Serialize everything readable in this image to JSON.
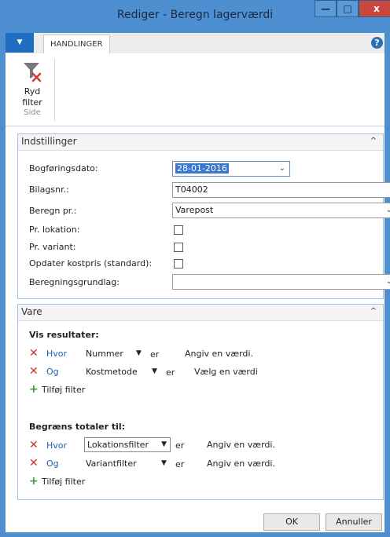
{
  "window": {
    "title": "Rediger - Beregn lagerværdi",
    "minimize": "—",
    "maximize": "□",
    "close": "x"
  },
  "ribbon": {
    "tab": "HANDLINGER",
    "clear_filter_line1": "Ryd",
    "clear_filter_line2": "filter",
    "group_label": "Side",
    "help": "?"
  },
  "settings": {
    "title": "Indstillinger",
    "fields": {
      "posting_date_label": "Bogføringsdato:",
      "posting_date_value": "28-01-2016",
      "document_no_label": "Bilagsnr.:",
      "document_no_value": "T04002",
      "calc_per_label": "Beregn pr.:",
      "calc_per_value": "Varepost",
      "by_location_label": "Pr. lokation:",
      "by_variant_label": "Pr. variant:",
      "update_std_cost_label": "Opdater kostpris (standard):",
      "calc_base_label": "Beregningsgrundlag:",
      "calc_base_value": ""
    }
  },
  "item": {
    "title": "Vare",
    "show_results": {
      "heading": "Vis resultater:",
      "rows": [
        {
          "conj": "Hvor",
          "field": "Nummer",
          "op": "er",
          "value": "Angiv en værdi."
        },
        {
          "conj": "Og",
          "field": "Kostmetode",
          "op": "er",
          "value": "Vælg en værdi"
        }
      ],
      "add_filter": "Tilføj filter"
    },
    "limit_totals": {
      "heading": "Begræns totaler til:",
      "rows": [
        {
          "conj": "Hvor",
          "field": "Lokationsfilter",
          "op": "er",
          "value": "Angiv en værdi."
        },
        {
          "conj": "Og",
          "field": "Variantfilter",
          "op": "er",
          "value": "Angiv en værdi."
        }
      ],
      "add_filter": "Tilføj filter"
    }
  },
  "buttons": {
    "ok": "OK",
    "cancel": "Annuller"
  },
  "colors": {
    "accent": "#4d8fd0",
    "remove": "#c8342a",
    "add": "#3a9a3a",
    "link": "#1f5fae"
  }
}
